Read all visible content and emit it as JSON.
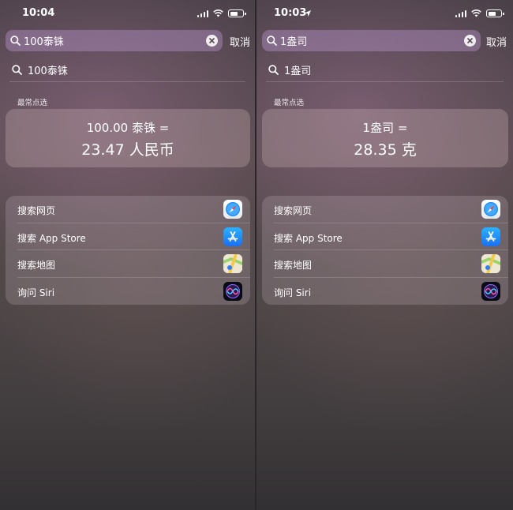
{
  "panels": [
    {
      "time": "10:04",
      "search_text": "100泰铢",
      "cancel_label": "取消",
      "suggestion": "100泰铢",
      "section_title": "最常点选",
      "result_line1": "100.00 泰铢 =",
      "result_line2": "23.47 人民币",
      "actions": [
        {
          "label": "搜索网页",
          "icon": "safari-icon"
        },
        {
          "label": "搜索 App Store",
          "icon": "app-store-icon"
        },
        {
          "label": "搜索地图",
          "icon": "maps-icon"
        },
        {
          "label": "询问 Siri",
          "icon": "siri-icon"
        }
      ]
    },
    {
      "time": "10:03",
      "search_text": "1盎司",
      "cancel_label": "取消",
      "suggestion": "1盎司",
      "section_title": "最常点选",
      "result_line1": "1盎司 =",
      "result_line2": "28.35 克",
      "actions": [
        {
          "label": "搜索网页",
          "icon": "safari-icon"
        },
        {
          "label": "搜索 App Store",
          "icon": "app-store-icon"
        },
        {
          "label": "搜索地图",
          "icon": "maps-icon"
        },
        {
          "label": "询问 Siri",
          "icon": "siri-icon"
        }
      ]
    }
  ]
}
